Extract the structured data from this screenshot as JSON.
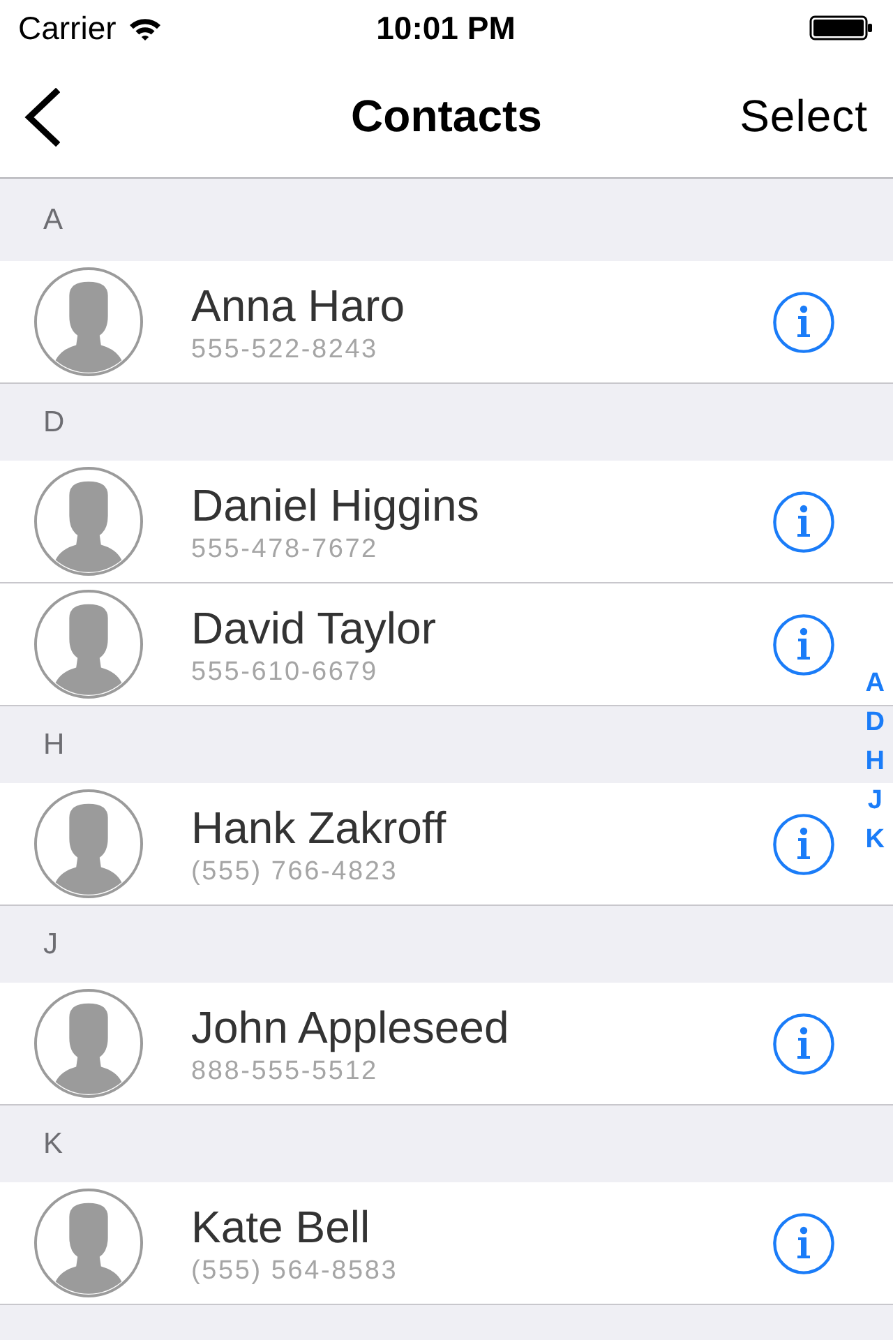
{
  "status_bar": {
    "carrier": "Carrier",
    "time": "10:01 PM"
  },
  "nav_bar": {
    "title": "Contacts",
    "right_button": "Select"
  },
  "sections": [
    {
      "letter": "A",
      "contacts": [
        {
          "name": "Anna Haro",
          "phone": "555-522-8243"
        }
      ]
    },
    {
      "letter": "D",
      "contacts": [
        {
          "name": "Daniel Higgins",
          "phone": "555-478-7672"
        },
        {
          "name": "David Taylor",
          "phone": "555-610-6679"
        }
      ]
    },
    {
      "letter": "H",
      "contacts": [
        {
          "name": "Hank Zakroff",
          "phone": "(555) 766-4823"
        }
      ]
    },
    {
      "letter": "J",
      "contacts": [
        {
          "name": "John Appleseed",
          "phone": "888-555-5512"
        }
      ]
    },
    {
      "letter": "K",
      "contacts": [
        {
          "name": "Kate Bell",
          "phone": "(555) 564-8583"
        }
      ]
    }
  ],
  "section_index": [
    "A",
    "D",
    "H",
    "J",
    "K"
  ]
}
